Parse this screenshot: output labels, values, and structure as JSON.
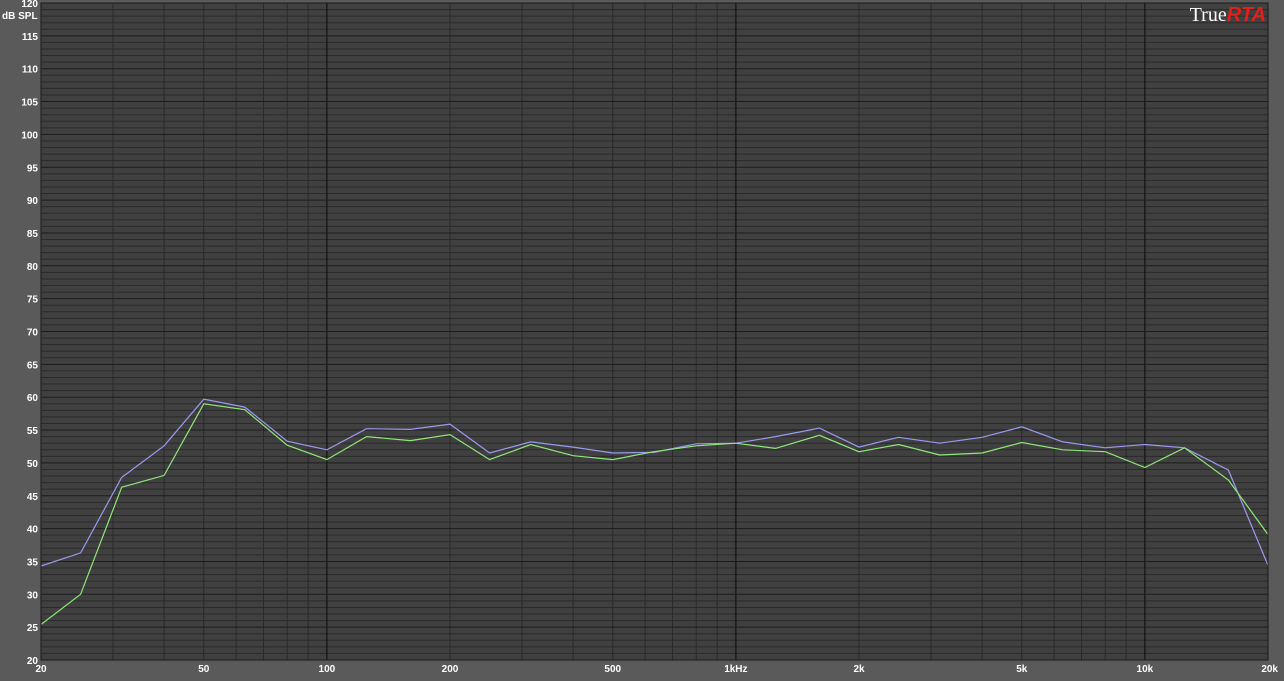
{
  "chart_data": {
    "type": "line",
    "ylabel": "dB SPL",
    "xscale": "log",
    "xlim": [
      20,
      20000
    ],
    "ylim": [
      20,
      120
    ],
    "grid": true,
    "y_ticks": [
      20,
      25,
      30,
      35,
      40,
      45,
      50,
      55,
      60,
      65,
      70,
      75,
      80,
      85,
      90,
      95,
      100,
      105,
      110,
      115,
      120
    ],
    "x_ticks": [
      {
        "value": 20,
        "label": "20"
      },
      {
        "value": 50,
        "label": "50"
      },
      {
        "value": 100,
        "label": "100"
      },
      {
        "value": 200,
        "label": "200"
      },
      {
        "value": 500,
        "label": "500"
      },
      {
        "value": 1000,
        "label": "1kHz"
      },
      {
        "value": 2000,
        "label": "2k"
      },
      {
        "value": 5000,
        "label": "5k"
      },
      {
        "value": 10000,
        "label": "10k"
      },
      {
        "value": 20000,
        "label": "20k"
      }
    ],
    "x": [
      20,
      25,
      31.5,
      40,
      50,
      63,
      80,
      100,
      125,
      160,
      200,
      250,
      315,
      400,
      500,
      630,
      800,
      1000,
      1250,
      1600,
      2000,
      2500,
      3150,
      4000,
      5000,
      6300,
      8000,
      10000,
      12500,
      16000,
      20000
    ],
    "series": [
      {
        "color": "#9a9af0",
        "values": [
          34.3,
          36.3,
          47.8,
          52.6,
          59.7,
          58.5,
          53.3,
          52.0,
          55.2,
          55.1,
          55.9,
          51.5,
          53.2,
          52.4,
          51.5,
          51.6,
          52.9,
          53.0,
          54.0,
          55.3,
          52.4,
          53.9,
          53.0,
          53.9,
          55.5,
          53.2,
          52.3,
          52.8,
          52.3,
          48.9,
          34.4
        ]
      },
      {
        "color": "#8ee878",
        "values": [
          25.4,
          30.0,
          46.3,
          48.1,
          59.0,
          58.1,
          52.7,
          50.5,
          54.0,
          53.4,
          54.3,
          50.5,
          52.8,
          51.1,
          50.5,
          51.7,
          52.6,
          53.0,
          52.2,
          54.2,
          51.7,
          52.8,
          51.2,
          51.5,
          53.1,
          52.0,
          51.7,
          49.3,
          52.3,
          47.4,
          39.1
        ]
      }
    ]
  },
  "logo": {
    "part1": "True",
    "part2": "RTA"
  }
}
